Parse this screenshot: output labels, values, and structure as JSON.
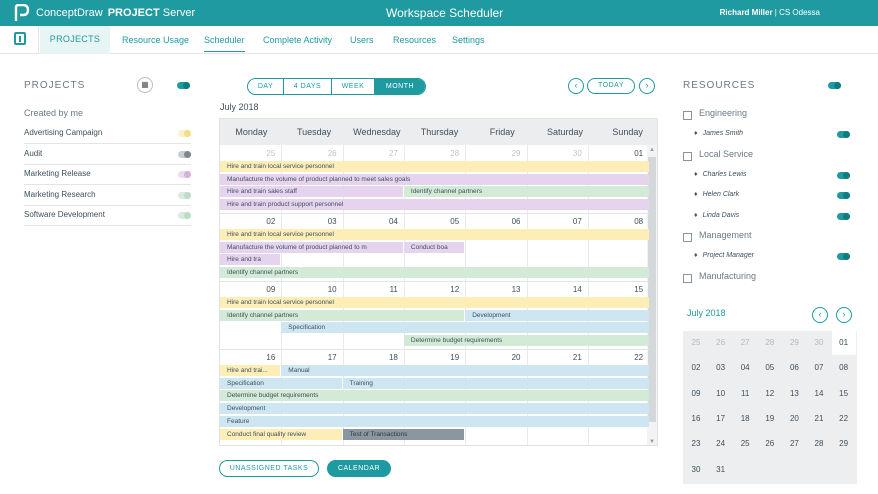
{
  "header": {
    "brand": "ConceptDraw",
    "brand_bold": "PROJECT",
    "brand_suffix": "Server",
    "app_title": "Workspace Scheduler",
    "user_name": "Richard Miller",
    "user_org": "CS Odessa",
    "accent": "#1e9aa0"
  },
  "nav": {
    "projects": "PROJECTS",
    "tabs": [
      "Resource Usage",
      "Scheduler",
      "Complete Activity",
      "Users",
      "Resources",
      "Settings"
    ],
    "active": "Scheduler"
  },
  "projects": {
    "title": "PROJECTS",
    "subtitle": "Created by me",
    "items": [
      {
        "name": "Advertising Campaign",
        "toggle": "yellow"
      },
      {
        "name": "Audit",
        "toggle": "grey"
      },
      {
        "name": "Marketing Release",
        "toggle": "pink"
      },
      {
        "name": "Marketing Research",
        "toggle": "green"
      },
      {
        "name": "Software Development",
        "toggle": "green"
      }
    ]
  },
  "calendar": {
    "views": [
      "DAY",
      "4 DAYS",
      "WEEK",
      "MONTH"
    ],
    "active_view": "MONTH",
    "today": "TODAY",
    "month_label": "July 2018",
    "days": [
      "Monday",
      "Tuesday",
      "Wednesday",
      "Thursday",
      "Friday",
      "Saturday",
      "Sunday"
    ],
    "weeks": [
      {
        "dates": [
          "25",
          "26",
          "27",
          "28",
          "29",
          "30",
          "01"
        ],
        "dim": [
          true,
          true,
          true,
          true,
          true,
          true,
          false
        ],
        "bars": [
          {
            "text": "Hire and train local service personnel",
            "color": "y",
            "start": 0,
            "end": 7,
            "row": 0
          },
          {
            "text": "Manufacture the volume of product planned to meet sales goals",
            "color": "p",
            "start": 0,
            "end": 7,
            "row": 1
          },
          {
            "text": "Hire and train sales staff",
            "color": "p",
            "start": 0,
            "end": 3,
            "row": 2
          },
          {
            "text": "Identify channel partners",
            "color": "g",
            "start": 3,
            "end": 7,
            "row": 2
          },
          {
            "text": "Hire and train product support personnel",
            "color": "p",
            "start": 0,
            "end": 7,
            "row": 3
          }
        ]
      },
      {
        "dates": [
          "02",
          "03",
          "04",
          "05",
          "06",
          "07",
          "08"
        ],
        "dim": [
          false,
          false,
          false,
          false,
          false,
          false,
          false
        ],
        "bars": [
          {
            "text": "Hire and train local service personnel",
            "color": "y",
            "start": 0,
            "end": 7,
            "row": 0
          },
          {
            "text": "Manufacture the volume of product planned to m",
            "color": "p",
            "start": 0,
            "end": 3,
            "row": 1
          },
          {
            "text": "Conduct boa",
            "color": "p",
            "start": 3,
            "end": 4,
            "row": 1
          },
          {
            "text": "Hire and tra",
            "color": "p",
            "start": 0,
            "end": 1,
            "row": 2
          },
          {
            "text": "Identify channel partners",
            "color": "g",
            "start": 0,
            "end": 7,
            "row": 3
          }
        ]
      },
      {
        "dates": [
          "09",
          "10",
          "11",
          "12",
          "13",
          "14",
          "15"
        ],
        "dim": [
          false,
          false,
          false,
          false,
          false,
          false,
          false
        ],
        "bars": [
          {
            "text": "Hire and train local service personnel",
            "color": "y",
            "start": 0,
            "end": 7,
            "row": 0
          },
          {
            "text": "Identify channel partners",
            "color": "g",
            "start": 0,
            "end": 4,
            "row": 1
          },
          {
            "text": "Development",
            "color": "b",
            "start": 4,
            "end": 7,
            "row": 1
          },
          {
            "text": "Specification",
            "color": "b",
            "start": 1,
            "end": 7,
            "row": 2
          },
          {
            "text": "Determine budget requirements",
            "color": "g",
            "start": 3,
            "end": 7,
            "row": 3
          }
        ]
      },
      {
        "dates": [
          "16",
          "17",
          "18",
          "19",
          "20",
          "21",
          "22"
        ],
        "dim": [
          false,
          false,
          false,
          false,
          false,
          false,
          false
        ],
        "bars": [
          {
            "text": "Hire and trai...",
            "color": "y",
            "start": 0,
            "end": 1,
            "row": 0
          },
          {
            "text": "Manual",
            "color": "b",
            "start": 1,
            "end": 7,
            "row": 0
          },
          {
            "text": "Specification",
            "color": "b",
            "start": 0,
            "end": 2,
            "row": 1
          },
          {
            "text": "Training",
            "color": "b",
            "start": 2,
            "end": 7,
            "row": 1
          },
          {
            "text": "Determine budget requirements",
            "color": "g",
            "start": 0,
            "end": 7,
            "row": 2
          },
          {
            "text": "Development",
            "color": "b",
            "start": 0,
            "end": 7,
            "row": 3
          },
          {
            "text": "Feature",
            "color": "b",
            "start": 0,
            "end": 7,
            "row": 4
          },
          {
            "text": "Conduct final quality review",
            "color": "y",
            "start": 0,
            "end": 2,
            "row": 5
          },
          {
            "text": "Test of Transactions",
            "color": "d",
            "start": 2,
            "end": 4,
            "row": 5
          }
        ]
      }
    ],
    "unassigned": "UNASSIGNED TASKS",
    "calendar_btn": "CALENDAR"
  },
  "resources": {
    "title": "RESOURCES",
    "groups": [
      {
        "name": "Engineering",
        "people": [
          "James Smith"
        ]
      },
      {
        "name": "Local Service",
        "people": [
          "Charles Lewis",
          "Helen Clark",
          "Linda Davis"
        ]
      },
      {
        "name": "Management",
        "people": [
          "Project Manager"
        ]
      },
      {
        "name": "Manufacturing",
        "people": []
      }
    ]
  },
  "minical": {
    "title": "July 2018",
    "rows": [
      [
        "25",
        "26",
        "27",
        "28",
        "29",
        "30",
        "01"
      ],
      [
        "02",
        "03",
        "04",
        "05",
        "06",
        "07",
        "08"
      ],
      [
        "09",
        "10",
        "11",
        "12",
        "13",
        "14",
        "15"
      ],
      [
        "16",
        "17",
        "18",
        "19",
        "20",
        "21",
        "22"
      ],
      [
        "23",
        "24",
        "25",
        "26",
        "27",
        "28",
        "29"
      ],
      [
        "30",
        "31",
        "",
        "",
        "",
        "",
        ""
      ]
    ]
  }
}
